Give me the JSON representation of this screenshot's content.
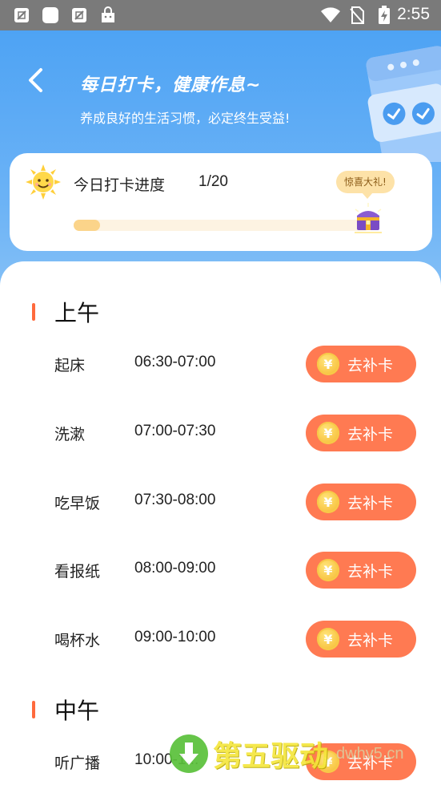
{
  "status_bar": {
    "time": "2:55",
    "icons": [
      "no-sim-card-icon",
      "app-notification-icon",
      "no-sim-card-icon",
      "shop-icon",
      "wifi-icon",
      "no-signal-icon",
      "battery-charging-icon"
    ]
  },
  "header": {
    "title": "每日打卡，健康作息~",
    "subtitle": "养成良好的生活习惯，必定终生受益!"
  },
  "progress": {
    "label": "今日打卡进度",
    "count_text": "1/20",
    "done": 1,
    "total": 20,
    "gift_tip": "惊喜大礼!"
  },
  "sections": [
    {
      "title": "上午",
      "items": [
        {
          "name": "起床",
          "time": "06:30-07:00",
          "button": "去补卡"
        },
        {
          "name": "洗漱",
          "time": "07:00-07:30",
          "button": "去补卡"
        },
        {
          "name": "吃早饭",
          "time": "07:30-08:00",
          "button": "去补卡"
        },
        {
          "name": "看报纸",
          "time": "08:00-09:00",
          "button": "去补卡"
        },
        {
          "name": "喝杯水",
          "time": "09:00-10:00",
          "button": "去补卡"
        }
      ]
    },
    {
      "title": "中午",
      "items": [
        {
          "name": "听广播",
          "time": "10:00-1...",
          "button": "去补卡"
        }
      ]
    }
  ],
  "watermark": {
    "text": "第五驱动",
    "site": "dwhv5.cn"
  },
  "colors": {
    "header_blue": "#4ea3f4",
    "accent_orange": "#ff7a52",
    "section_bar": "#ff6a3d",
    "progress_fill": "#fbd48a"
  }
}
